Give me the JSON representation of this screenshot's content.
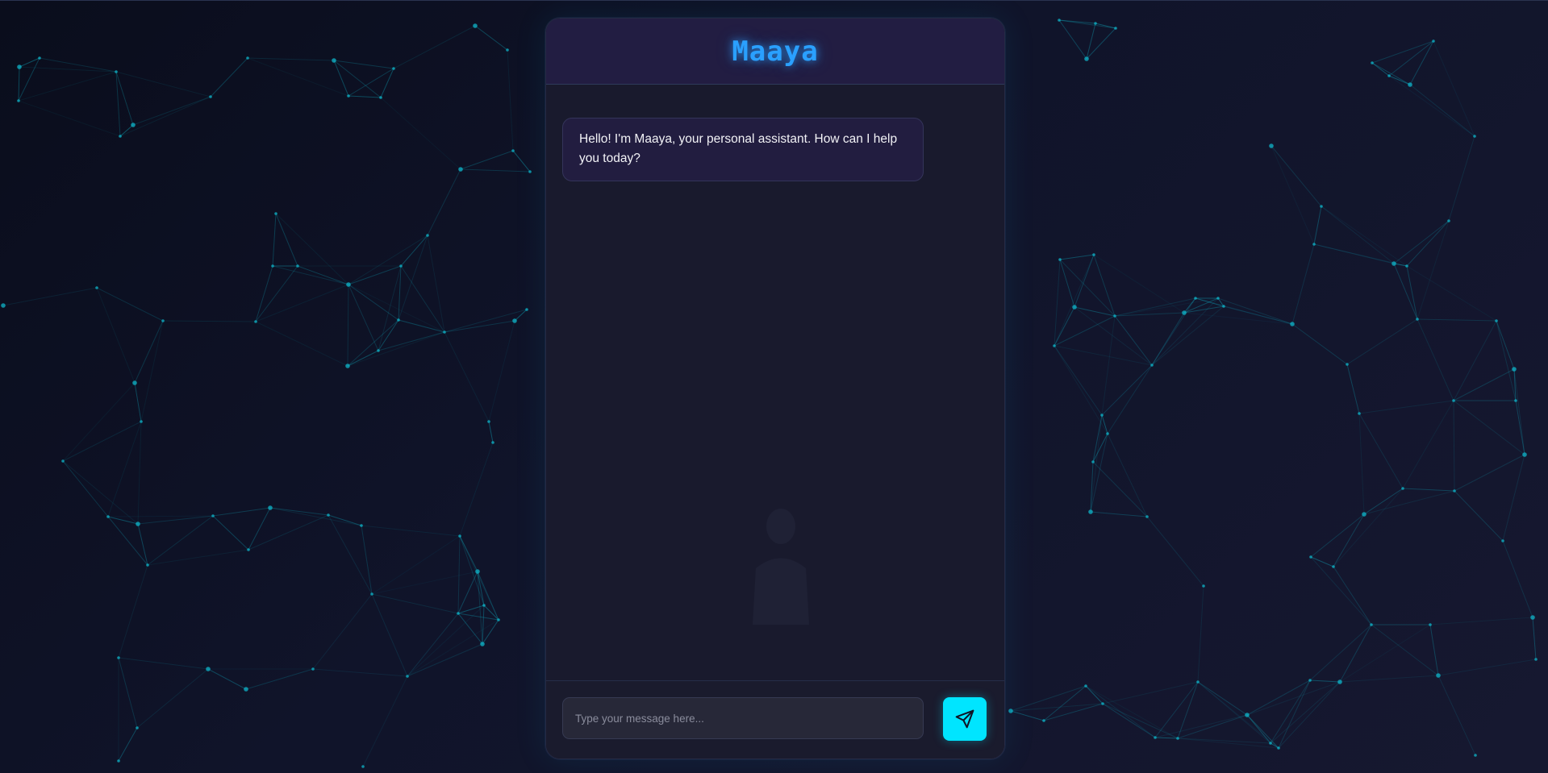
{
  "app": {
    "title": "Maaya"
  },
  "messages": [
    {
      "sender": "assistant",
      "text": "Hello! I'm Maaya, your personal assistant. How can I help you today?"
    }
  ],
  "composer": {
    "value": "",
    "placeholder": "Type your message here...",
    "send_icon": "send-paper-plane-icon"
  },
  "colors": {
    "accent": "#00e5ff",
    "title": "#2aa0ff",
    "header_bg": "#221d42",
    "bubble_bg": "#221d40",
    "network_lines": "#0fb4c8"
  }
}
